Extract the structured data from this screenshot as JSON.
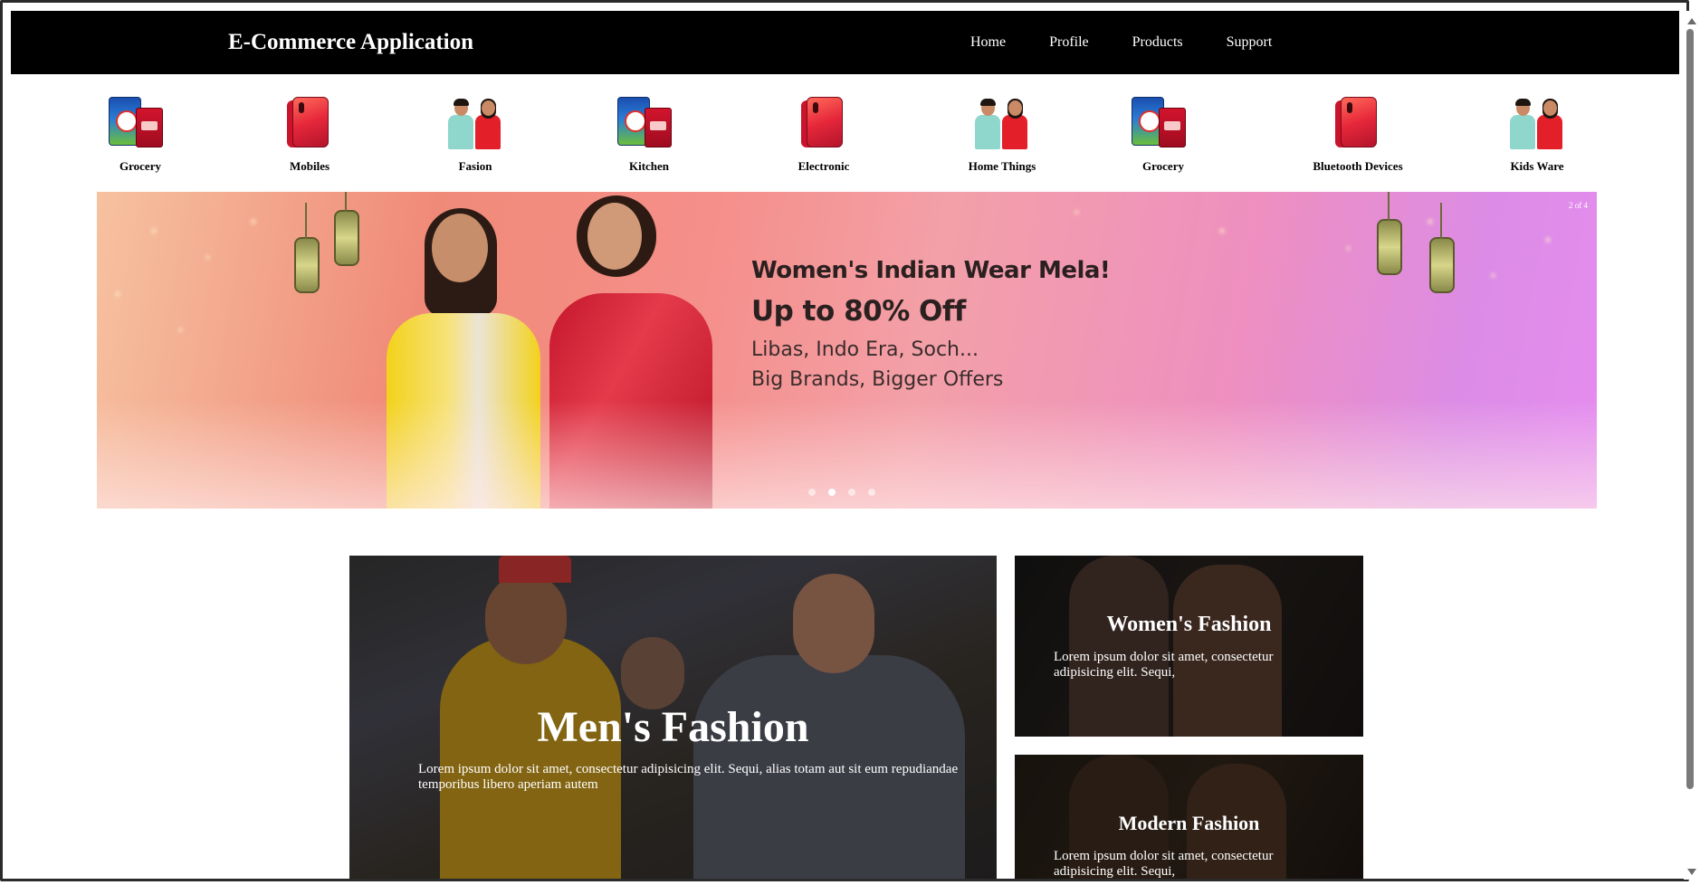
{
  "header": {
    "brand": "E-Commerce Application",
    "nav": [
      "Home",
      "Profile",
      "Products",
      "Support"
    ]
  },
  "categories": [
    {
      "label": "Grocery",
      "icon": "grocery-icon"
    },
    {
      "label": "Mobiles",
      "icon": "mobile-phone-icon"
    },
    {
      "label": "Fasion",
      "icon": "fashion-people-icon"
    },
    {
      "label": "Kitchen",
      "icon": "grocery-icon"
    },
    {
      "label": "Electronic",
      "icon": "mobile-phone-icon"
    },
    {
      "label": "Home Things",
      "icon": "fashion-people-icon"
    },
    {
      "label": "Grocery",
      "icon": "grocery-icon"
    },
    {
      "label": "Bluetooth Devices",
      "icon": "mobile-phone-icon"
    },
    {
      "label": "Kids Ware",
      "icon": "fashion-people-icon"
    }
  ],
  "banner": {
    "title": "Women's Indian Wear Mela!",
    "headline": "Up to 80% Off",
    "line1": "Libas, Indo Era, Soch...",
    "line2": "Big Brands, Bigger Offers",
    "slide_counter": "2 of 4",
    "active_slide": 2,
    "slide_count": 4
  },
  "cards": {
    "men": {
      "title": "Men's Fashion",
      "text": "Lorem ipsum dolor sit amet, consectetur adipisicing elit. Sequi, alias totam aut sit eum repudiandae temporibus libero aperiam autem"
    },
    "women": {
      "title": "Women's Fashion",
      "text": "Lorem ipsum dolor sit amet, consectetur adipisicing elit. Sequi,"
    },
    "modern": {
      "title": "Modern Fashion",
      "text": "Lorem ipsum dolor sit amet, consectetur adipisicing elit. Sequi,"
    }
  },
  "colors": {
    "navbar_bg": "#000000",
    "navbar_text": "#ffffff",
    "page_bg": "#ffffff"
  }
}
